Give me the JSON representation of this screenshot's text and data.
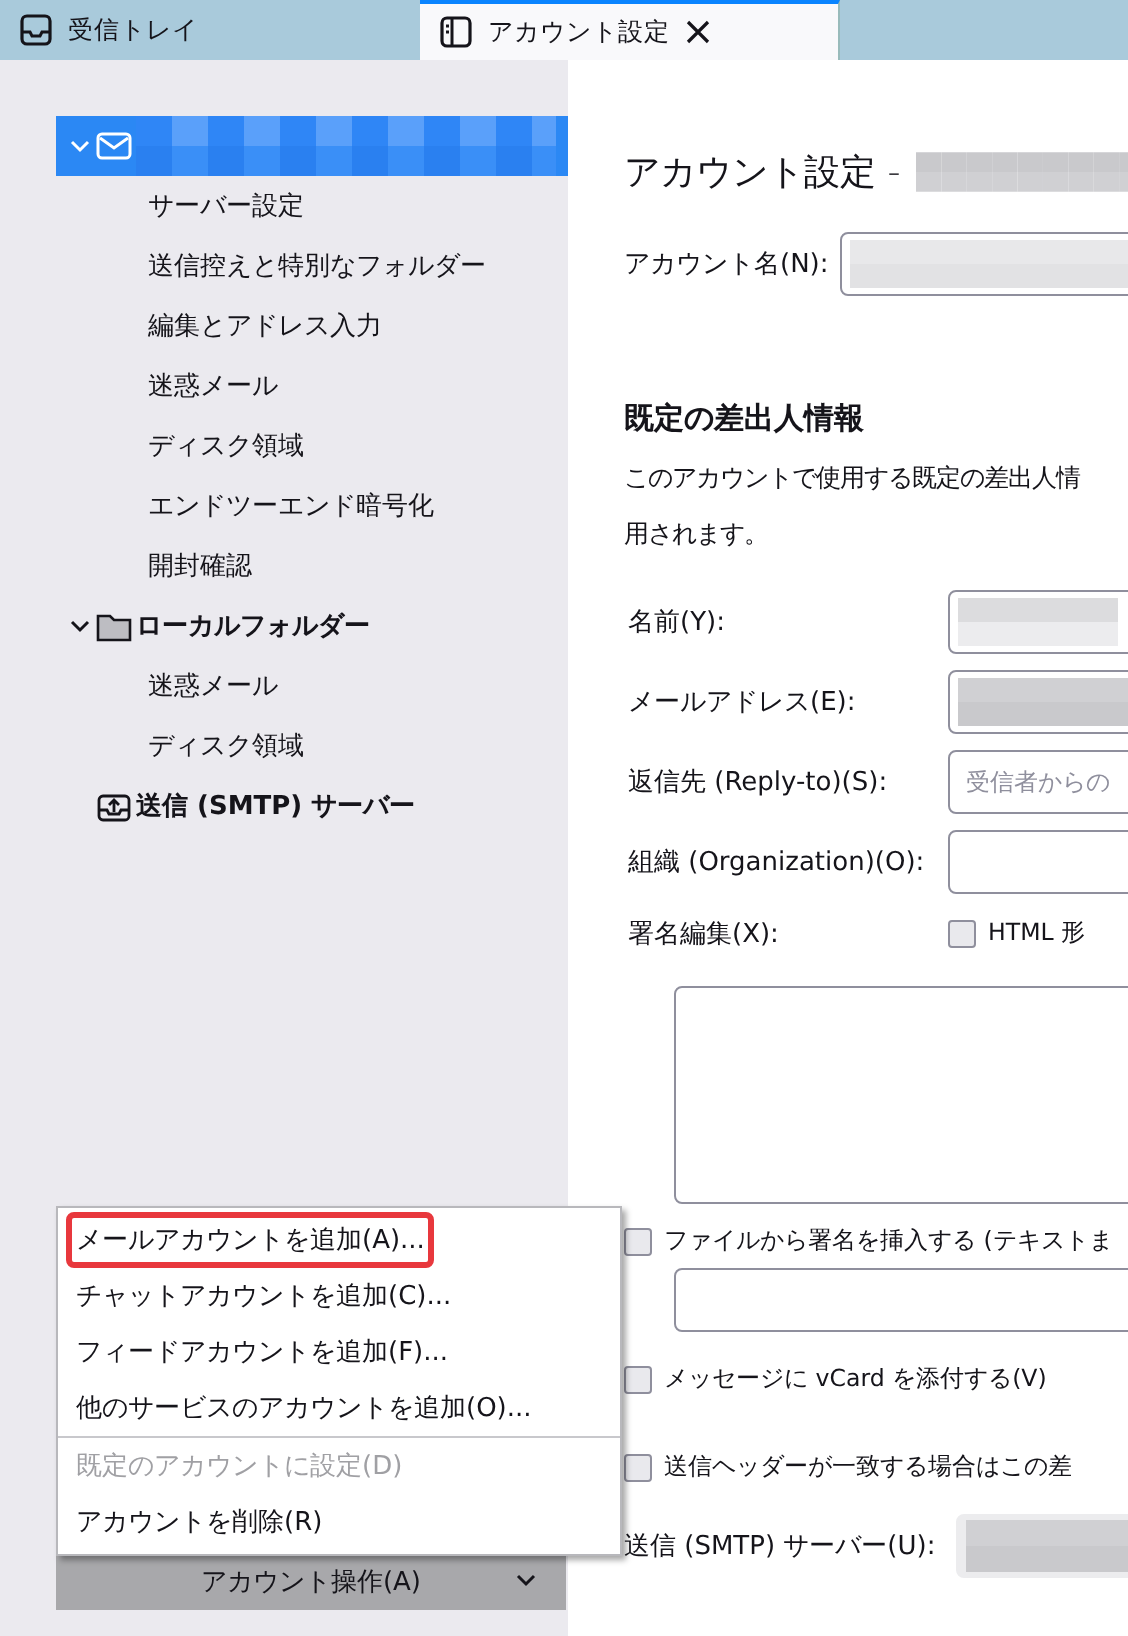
{
  "tabs": [
    {
      "label": "受信トレイ",
      "kind": "inbox",
      "selected": false,
      "closable": false
    },
    {
      "label": "アカウント設定",
      "kind": "settings",
      "selected": true,
      "closable": true
    }
  ],
  "sidebar": {
    "tree": [
      {
        "kind": "mail",
        "redacted": true,
        "selected": true,
        "expanded": true,
        "children": [
          {
            "label": "サーバー設定",
            "selected": false
          },
          {
            "label": "送信控えと特別なフォルダー",
            "selected": false
          },
          {
            "label": "編集とアドレス入力",
            "selected": false
          },
          {
            "label": "迷惑メール",
            "selected": false
          },
          {
            "label": "ディスク領域",
            "selected": false
          },
          {
            "label": "エンドツーエンド暗号化",
            "selected": false
          },
          {
            "label": "開封確認",
            "selected": false
          }
        ]
      },
      {
        "label": "ローカルフォルダー",
        "kind": "folder",
        "redacted": false,
        "selected": false,
        "expanded": true,
        "children": [
          {
            "label": "迷惑メール",
            "selected": false
          },
          {
            "label": "ディスク領域",
            "selected": false
          }
        ]
      },
      {
        "label": "送信 (SMTP) サーバー",
        "kind": "smtp",
        "redacted": false,
        "selected": false,
        "expanded": false
      }
    ],
    "account_actions_button": {
      "label": "アカウント操作(A)",
      "pressed": true
    },
    "menu": [
      {
        "kind": "item",
        "label": "メールアカウントを追加(A)...",
        "disabled": false,
        "highlighted": true
      },
      {
        "kind": "item",
        "label": "チャットアカウントを追加(C)...",
        "disabled": false,
        "highlighted": false
      },
      {
        "kind": "item",
        "label": "フィードアカウントを追加(F)...",
        "disabled": false,
        "highlighted": false
      },
      {
        "kind": "item",
        "label": "他のサービスのアカウントを追加(O)...",
        "disabled": false,
        "highlighted": false
      },
      {
        "kind": "separator"
      },
      {
        "kind": "item",
        "label": "既定のアカウントに設定(D)",
        "disabled": true,
        "highlighted": false
      },
      {
        "kind": "item",
        "label": "アカウントを削除(R)",
        "disabled": false,
        "highlighted": false
      }
    ]
  },
  "content": {
    "title": "アカウント設定 -",
    "title_redacted": true,
    "account_name": {
      "label": "アカウント名(N):",
      "redacted": true
    },
    "section_heading": "既定の差出人情報",
    "description_line_1": "このアカウントで使用する既定の差出人情",
    "description_line_2": "用されます。",
    "fields": [
      {
        "label": "名前(Y):",
        "kind": "text",
        "redacted": true
      },
      {
        "label": "メールアドレス(E):",
        "kind": "text",
        "redacted": true
      },
      {
        "label": "返信先 (Reply-to)(S):",
        "kind": "text",
        "redacted": false,
        "placeholder": "受信者からの"
      },
      {
        "label": "組織 (Organization)(O):",
        "kind": "text",
        "redacted": false
      },
      {
        "label": "署名編集(X):",
        "kind": "checkbox",
        "checkbox_label": "HTML 形",
        "checked": false
      }
    ],
    "signature_file": {
      "label": "ファイルから署名を挿入する (テキストま",
      "checked": false
    },
    "vcard": {
      "label": "メッセージに vCard を添付する(V)",
      "checked": false
    },
    "header_match": {
      "label": "送信ヘッダーが一致する場合はこの差",
      "checked": false
    },
    "smtp": {
      "label": "送信 (SMTP) サーバー(U):",
      "redacted": true
    }
  }
}
